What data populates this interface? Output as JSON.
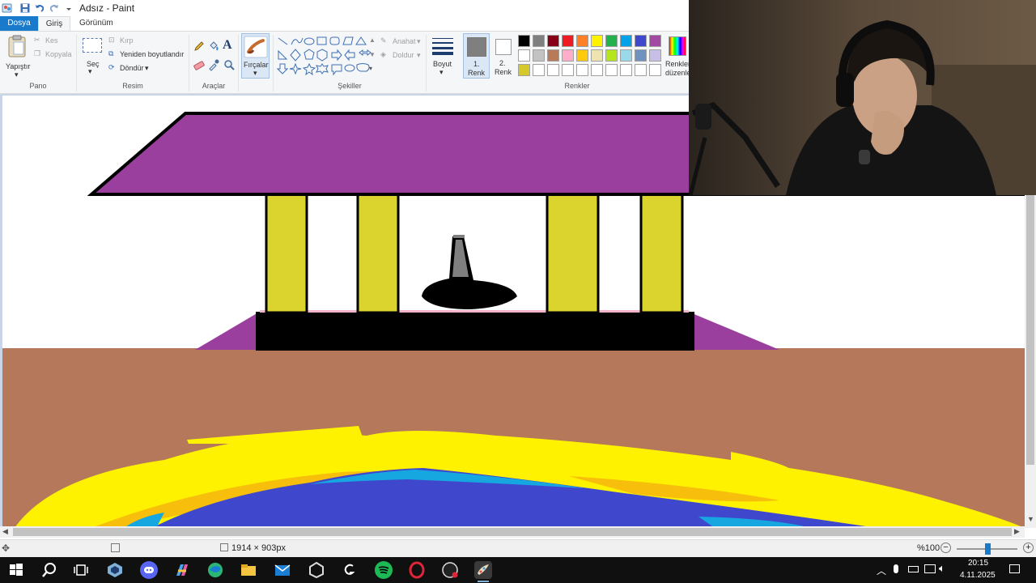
{
  "app": {
    "title": "Adsız - Paint"
  },
  "tabs": {
    "file": "Dosya",
    "home": "Giriş",
    "view": "Görünüm"
  },
  "ribbon": {
    "clipboard": {
      "paste": "Yapıştır",
      "cut": "Kes",
      "copy": "Kopyala",
      "group": "Pano"
    },
    "image": {
      "select": "Seç",
      "crop": "Kırp",
      "resize": "Yeniden boyutlandır",
      "rotate": "Döndür",
      "group": "Resim"
    },
    "tools": {
      "group": "Araçlar"
    },
    "brushes": {
      "label": "Fırçalar"
    },
    "shapes": {
      "outline": "Anahat",
      "fill": "Doldur",
      "group": "Şekiller"
    },
    "size": {
      "label": "Boyut"
    },
    "colors": {
      "color1_line1": "1.",
      "color1_line2": "Renk",
      "color2_line1": "2.",
      "color2_line2": "Renk",
      "edit_line1": "Renkleri",
      "edit_line2": "düzenle",
      "group": "Renkler",
      "color1_value": "#7f7f7f",
      "color2_value": "#ffffff",
      "palette_row1": [
        "#000000",
        "#7f7f7f",
        "#880015",
        "#ed1c24",
        "#ff7f27",
        "#fff200",
        "#22b14c",
        "#00a2e8",
        "#3f48cc",
        "#a349a4"
      ],
      "palette_row2": [
        "#ffffff",
        "#c3c3c3",
        "#b97a57",
        "#ffaec9",
        "#ffc90e",
        "#efe4b0",
        "#b5e61d",
        "#99d9ea",
        "#7092be",
        "#c8bfe7"
      ],
      "palette_row3": [
        "#d4c82a",
        "#ffffff",
        "#ffffff",
        "#ffffff",
        "#ffffff",
        "#ffffff",
        "#ffffff",
        "#ffffff",
        "#ffffff",
        "#ffffff"
      ]
    }
  },
  "statusbar": {
    "dimensions": "1914 × 903px",
    "zoom": "%100",
    "zoom_level": 0.5
  },
  "taskbar": {
    "time": "20:15",
    "date": "4.11.2025"
  },
  "drawing": {
    "roof_color": "#9b3f9f",
    "pillar_color": "#dcd42e",
    "ground_color": "#b5785a",
    "base_color": "#000000",
    "water_color": "#3f48cc",
    "sand_color": "#fff200"
  }
}
